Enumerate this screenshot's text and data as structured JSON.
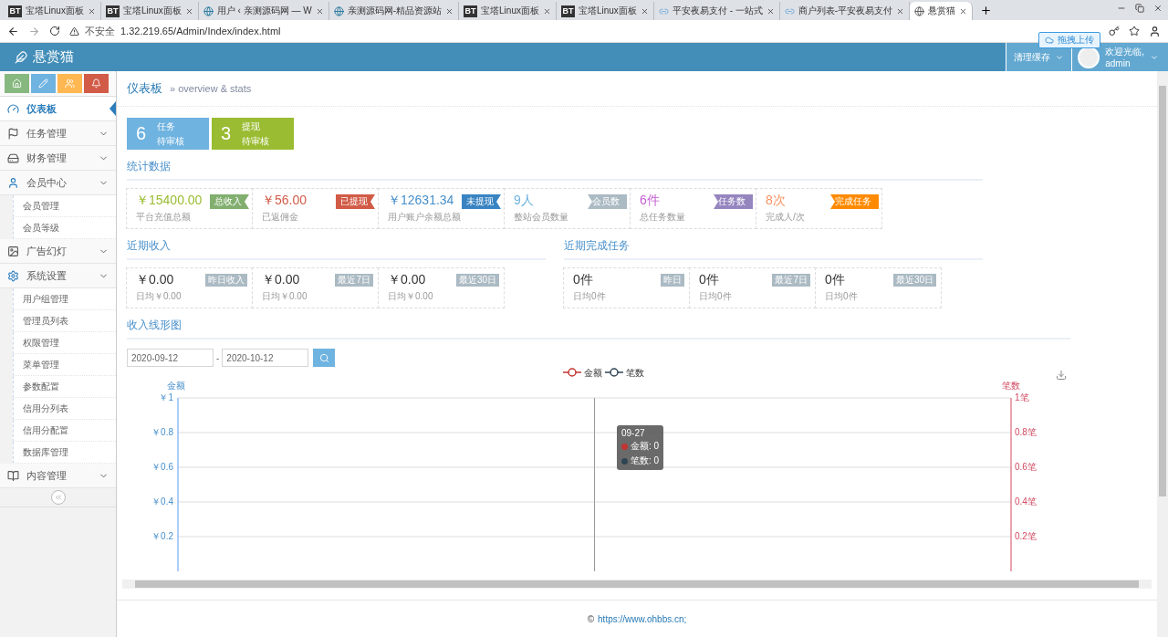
{
  "browser": {
    "tabs": [
      {
        "title": "宝塔Linux面板",
        "kind": "bt",
        "badge": "BT",
        "selected": false
      },
      {
        "title": "宝塔Linux面板",
        "kind": "bt",
        "badge": "BT",
        "selected": false
      },
      {
        "title": "用户 ‹ 亲测源码网 — W",
        "kind": "wp",
        "selected": false
      },
      {
        "title": "亲测源码网-精品资源站",
        "kind": "wp",
        "selected": false
      },
      {
        "title": "宝塔Linux面板",
        "kind": "bt",
        "badge": "BT",
        "selected": false
      },
      {
        "title": "宝塔Linux面板",
        "kind": "bt",
        "badge": "BT",
        "selected": false
      },
      {
        "title": "平安夜易支付 - 一站式",
        "kind": "link",
        "selected": false
      },
      {
        "title": "商户列表-平安夜易支付",
        "kind": "link",
        "selected": false
      },
      {
        "title": "悬赏猫",
        "kind": "globe",
        "selected": true
      }
    ],
    "security": "不安全",
    "url": "1.32.219.65/Admin/Index/index.html",
    "upload_button": "拖拽上传"
  },
  "header": {
    "logo": "悬赏猫",
    "clear_cache": "清理缓存",
    "welcome": "欢迎光临,",
    "user": "admin"
  },
  "sidebar": {
    "shortcuts": [
      {
        "kind": "home",
        "color": "#87b87f"
      },
      {
        "kind": "pencil",
        "color": "#6fb3e0"
      },
      {
        "kind": "users",
        "color": "#ffb752"
      },
      {
        "kind": "bell",
        "color": "#d15b47"
      }
    ],
    "items": [
      {
        "label": "仪表板",
        "kind": "link",
        "selected": true
      },
      {
        "label": "任务管理",
        "kind": "menu",
        "selected": false
      },
      {
        "label": "财务管理",
        "kind": "menu",
        "selected": false
      },
      {
        "label": "会员中心",
        "kind": "menu",
        "selected": false,
        "children": [
          {
            "label": "会员管理"
          },
          {
            "label": "会员等级"
          }
        ]
      },
      {
        "label": "广告幻灯",
        "kind": "menu",
        "selected": false
      },
      {
        "label": "系统设置",
        "kind": "menu",
        "selected": false,
        "children": [
          {
            "label": "用户组管理"
          },
          {
            "label": "管理员列表"
          },
          {
            "label": "权限管理"
          },
          {
            "label": "菜单管理"
          },
          {
            "label": "参数配置"
          },
          {
            "label": "信用分列表"
          },
          {
            "label": "信用分配置"
          },
          {
            "label": "数据库管理"
          }
        ]
      },
      {
        "label": "内容管理",
        "kind": "menu",
        "selected": false
      }
    ]
  },
  "breadcrumb": {
    "title": "仪表板",
    "subtitle": "» overview & stats"
  },
  "pending": [
    {
      "count": "6",
      "label": "任务",
      "sub": "待审核",
      "color": "#6fb3e0"
    },
    {
      "count": "3",
      "label": "提现",
      "sub": "待审核",
      "color": "#9abc32"
    }
  ],
  "stats": {
    "title": "统计数据",
    "items": [
      {
        "value": "￥15400.00",
        "caption": "平台充值总额",
        "color": "#9abc32",
        "badge": {
          "text": "总收入",
          "color": "#82af6f"
        }
      },
      {
        "value": "￥56.00",
        "caption": "已返佣金",
        "color": "#d15b47",
        "badge": {
          "text": "已提现",
          "color": "#d15b47"
        }
      },
      {
        "value": "￥12631.34",
        "caption": "用户账户余额总额",
        "color": "#478fca",
        "badge": {
          "text": "未提现",
          "color": "#3983c2"
        }
      },
      {
        "value": "9人",
        "caption": "整站会员数量",
        "color": "#6fb3e0",
        "badge": {
          "text": "会员数",
          "color": "#abbac3"
        }
      },
      {
        "value": "6件",
        "caption": "总任务数量",
        "color": "#c45cd1",
        "badge": {
          "text": "任务数",
          "color": "#9585bf"
        }
      },
      {
        "value": "8次",
        "caption": "完成人/次",
        "color": "#f79263",
        "badge": {
          "text": "完成任务",
          "color": "#ff8a00"
        }
      }
    ]
  },
  "recent_income": {
    "title": "近期收入",
    "items": [
      {
        "value": "￥0.00",
        "caption": "日均￥0.00",
        "badge": "昨日收入"
      },
      {
        "value": "￥0.00",
        "caption": "日均￥0.00",
        "badge": "最近7日"
      },
      {
        "value": "￥0.00",
        "caption": "日均￥0.00",
        "badge": "最近30日"
      }
    ]
  },
  "recent_tasks": {
    "title": "近期完成任务",
    "items": [
      {
        "value": "0件",
        "caption": "日均0件",
        "badge": "昨日"
      },
      {
        "value": "0件",
        "caption": "日均0件",
        "badge": "最近7日"
      },
      {
        "value": "0件",
        "caption": "日均0件",
        "badge": "最近30日"
      }
    ]
  },
  "income_chart": {
    "title": "收入线形图",
    "date_from": "2020-09-12",
    "separator": "-",
    "date_to": "2020-10-12",
    "chart_data": {
      "type": "line",
      "ylabel": "金额",
      "ylim": [
        0,
        1
      ],
      "grid": true,
      "yticks": [
        {
          "value": 1,
          "label": "￥1"
        },
        {
          "value": 0.8,
          "label": "￥0.8"
        },
        {
          "value": 0.6,
          "label": "￥0.6"
        },
        {
          "value": 0.4,
          "label": "￥0.4"
        },
        {
          "value": 0.2,
          "label": "￥0.2"
        }
      ],
      "y2label": "笔数",
      "y2lim": [
        0,
        1
      ],
      "y2ticks": [
        {
          "value": 1,
          "label": "1笔"
        },
        {
          "value": 0.8,
          "label": "0.8笔"
        },
        {
          "value": 0.6,
          "label": "0.6笔"
        },
        {
          "value": 0.4,
          "label": "0.4笔"
        },
        {
          "value": 0.2,
          "label": "0.2笔"
        }
      ],
      "series": [
        {
          "name": "金额",
          "color": "#c23531"
        },
        {
          "name": "笔数",
          "color": "#2f4554"
        }
      ]
    },
    "tooltip": {
      "title": "09-27",
      "rows": [
        {
          "label": "金额: 0",
          "color": "#c23531"
        },
        {
          "label": "笔数: 0",
          "color": "#2f4554"
        }
      ]
    }
  },
  "footer": {
    "copyright": "©",
    "link": "https://www.ohbbs.cn;"
  }
}
